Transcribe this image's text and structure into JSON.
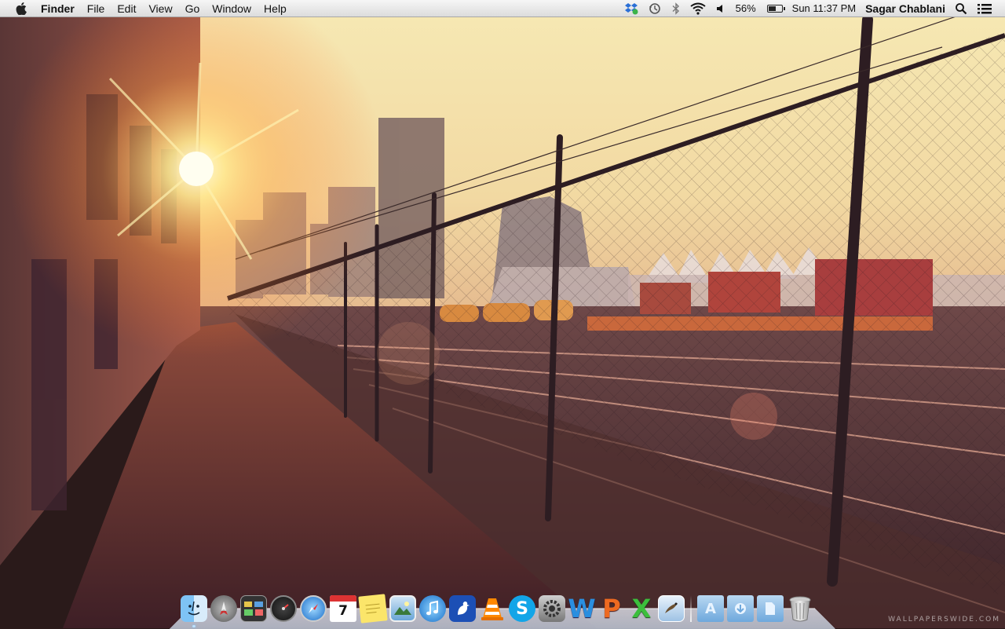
{
  "menubar": {
    "app_name": "Finder",
    "menus": [
      "File",
      "Edit",
      "View",
      "Go",
      "Window",
      "Help"
    ],
    "battery_percent_label": "56%",
    "battery_level": 0.56,
    "clock": "Sun 11:37 PM",
    "user_name": "Sagar Chablani",
    "status_icons": [
      "dropbox-icon",
      "time-machine-icon",
      "bluetooth-icon",
      "wifi-icon",
      "volume-icon",
      "battery-icon",
      "spotlight-icon",
      "notification-list-icon"
    ]
  },
  "dock": {
    "apps": [
      {
        "name": "Finder",
        "icon": "finder-icon",
        "running": true
      },
      {
        "name": "Launchpad",
        "icon": "launchpad-icon",
        "running": false
      },
      {
        "name": "Mission Control",
        "icon": "mission-control-icon",
        "running": false
      },
      {
        "name": "Dashboard",
        "icon": "dashboard-icon",
        "running": false
      },
      {
        "name": "Safari",
        "icon": "safari-icon",
        "running": false
      },
      {
        "name": "Calendar",
        "icon": "calendar-icon",
        "running": false,
        "label": "7"
      },
      {
        "name": "Stickies",
        "icon": "stickies-icon",
        "running": false
      },
      {
        "name": "Preview",
        "icon": "preview-icon",
        "running": false
      },
      {
        "name": "iTunes",
        "icon": "itunes-icon",
        "running": false
      },
      {
        "name": "Cyberduck",
        "icon": "cyberduck-icon",
        "running": false
      },
      {
        "name": "VLC",
        "icon": "vlc-icon",
        "running": false
      },
      {
        "name": "Skype",
        "icon": "skype-icon",
        "running": false
      },
      {
        "name": "System Preferences",
        "icon": "system-preferences-icon",
        "running": false
      },
      {
        "name": "Word",
        "icon": "word-icon",
        "running": false,
        "label": "W"
      },
      {
        "name": "PowerPoint",
        "icon": "powerpoint-icon",
        "running": false,
        "label": "P"
      },
      {
        "name": "Excel",
        "icon": "excel-icon",
        "running": false,
        "label": "X"
      },
      {
        "name": "Mail",
        "icon": "mail-icon",
        "running": false
      }
    ],
    "stacks": [
      {
        "name": "Applications",
        "icon": "applications-folder-icon"
      },
      {
        "name": "Downloads",
        "icon": "downloads-folder-icon"
      },
      {
        "name": "Documents",
        "icon": "documents-folder-icon"
      },
      {
        "name": "Trash",
        "icon": "trash-icon"
      }
    ]
  },
  "watermark": "WALLPAPERSWIDE.COM",
  "colors": {
    "sky": "#f7eebf",
    "sun": "#fff6c8",
    "path": "#7a3a35",
    "shadow": "#3a1f24"
  }
}
